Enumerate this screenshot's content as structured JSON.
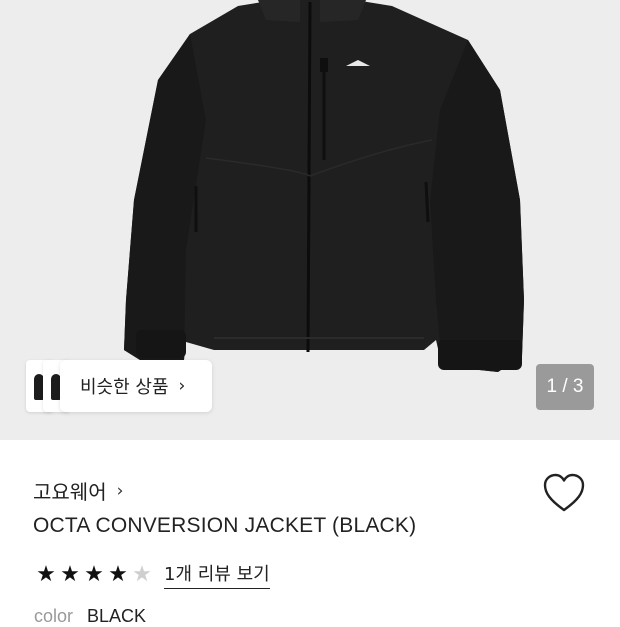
{
  "hero": {
    "image_alt": "black jacket product photo",
    "similar_label": "비슷한 상품",
    "similar_chevron_icon": "chevron-right-icon",
    "pager_text": "1 / 3",
    "current_image": 1,
    "total_images": 3
  },
  "product": {
    "brand": "고요웨어",
    "brand_chevron": "›",
    "title": "OCTA CONVERSION JACKET (BLACK)",
    "wishlist_icon": "heart-outline-icon",
    "rating": 4,
    "rating_max": 5,
    "review_link": "1개 리뷰 보기",
    "color_label": "color",
    "color_value": "BLACK"
  },
  "colors": {
    "background": "#ededed",
    "jacket": "#1f1f1f",
    "pager_bg": "#9a9a9a",
    "star_on": "#111111",
    "star_off": "#cfcfcf"
  }
}
